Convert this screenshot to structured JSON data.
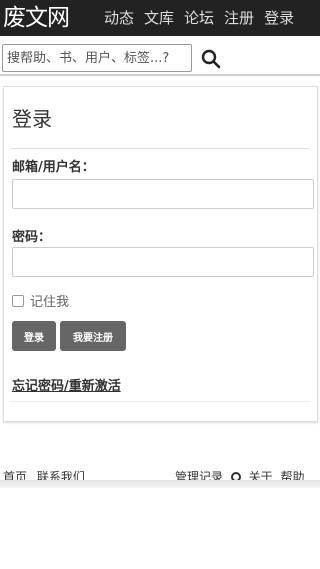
{
  "header": {
    "logo": "废文网",
    "nav": [
      "动态",
      "文库",
      "论坛",
      "注册",
      "登录"
    ]
  },
  "search": {
    "placeholder": "搜帮助、书、用户、标签...?",
    "button_icon": "search-icon"
  },
  "login": {
    "title": "登录",
    "email_label": "邮箱/用户名：",
    "password_label": "密码：",
    "email_value": "",
    "password_value": "",
    "remember_label": "记住我",
    "login_button": "登录",
    "register_button": "我要注册",
    "forgot_link": "忘记密码/重新激活"
  },
  "footer": {
    "home": "首页",
    "contact": "联系我们",
    "admin_log": "管理记录",
    "about": "关于",
    "help": "帮助"
  },
  "colors": {
    "topbar": "#222222",
    "button": "#666666",
    "text": "#333333"
  }
}
